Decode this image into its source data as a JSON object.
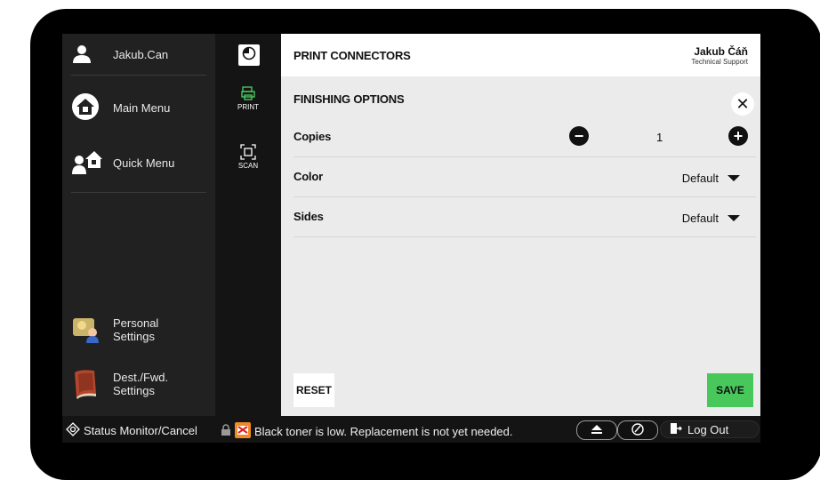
{
  "sidebar": {
    "user_label": "Jakub.Can",
    "main_menu": "Main Menu",
    "quick_menu": "Quick Menu",
    "personal_settings": [
      "Personal",
      "Settings"
    ],
    "dest_settings": [
      "Dest./Fwd.",
      "Settings"
    ]
  },
  "functions": {
    "print": "PRINT",
    "scan": "SCAN"
  },
  "header": {
    "title": "PRINT CONNECTORS",
    "user_name": "Jakub Čáň",
    "user_role": "Technical Support"
  },
  "finishing": {
    "title": "FINISHING OPTIONS",
    "copies_label": "Copies",
    "copies_value": "1",
    "color_label": "Color",
    "color_value": "Default",
    "sides_label": "Sides",
    "sides_value": "Default"
  },
  "actions": {
    "reset": "RESET",
    "save": "SAVE"
  },
  "status": {
    "monitor": "Status Monitor/Cancel",
    "message": "Black toner is low. Replacement is not yet needed.",
    "logout": "Log Out"
  },
  "colors": {
    "save": "#48c85a",
    "panel": "#ebebeb"
  },
  "icons": [
    "user-icon",
    "home-icon",
    "quick-menu-icon",
    "personal-settings-icon",
    "address-book-icon",
    "timer-icon",
    "print-icon",
    "scan-icon",
    "close-icon",
    "minus-icon",
    "plus-icon",
    "status-monitor-icon",
    "lock-icon",
    "warning-icon",
    "eject-icon",
    "ecology-icon",
    "logout-icon"
  ]
}
